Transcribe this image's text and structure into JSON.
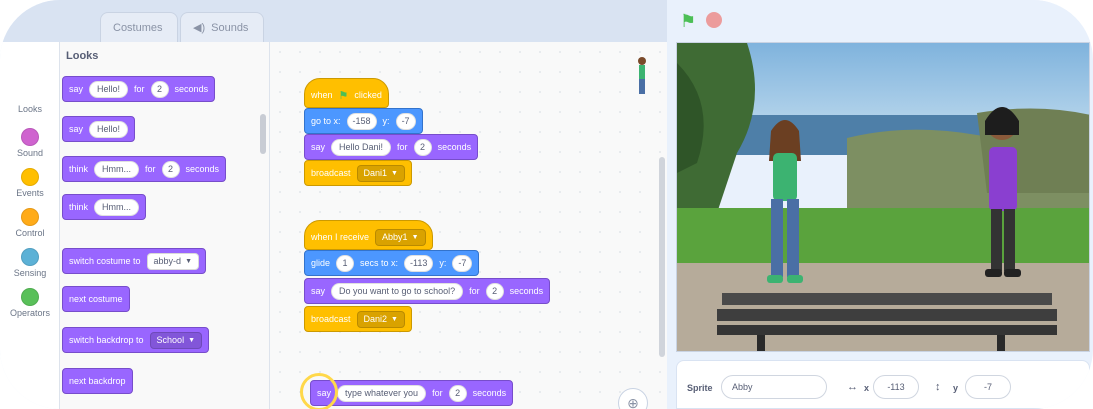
{
  "tabs": {
    "costumes": "Costumes",
    "sounds": "Sounds"
  },
  "categories": [
    {
      "label": "Looks",
      "color": "#9966ff",
      "icon": "looks-dot-icon"
    },
    {
      "label": "Sound",
      "color": "#cf63cf",
      "icon": "sound-dot-icon"
    },
    {
      "label": "Events",
      "color": "#ffbf00",
      "icon": "events-dot-icon"
    },
    {
      "label": "Control",
      "color": "#ffab19",
      "icon": "control-dot-icon"
    },
    {
      "label": "Sensing",
      "color": "#5cb1d6",
      "icon": "sensing-dot-icon"
    },
    {
      "label": "Operators",
      "color": "#59c059",
      "icon": "operators-dot-icon"
    }
  ],
  "palette": {
    "title": "Looks",
    "say_for": {
      "say": "say",
      "text": "Hello!",
      "for": "for",
      "secs": "2",
      "seconds": "seconds"
    },
    "say": {
      "say": "say",
      "text": "Hello!"
    },
    "think_for": {
      "think": "think",
      "text": "Hmm...",
      "for": "for",
      "secs": "2",
      "seconds": "seconds"
    },
    "think": {
      "think": "think",
      "text": "Hmm..."
    },
    "switch_costume": {
      "label": "switch costume to",
      "value": "abby-d"
    },
    "next_costume": "next costume",
    "switch_backdrop": {
      "label": "switch backdrop to",
      "value": "School"
    },
    "next_backdrop": "next backdrop"
  },
  "script1": {
    "when_clicked": {
      "when": "when",
      "clicked": "clicked"
    },
    "goto": {
      "label": "go to x:",
      "x": "-158",
      "y_label": "y:",
      "y": "-7"
    },
    "say_for": {
      "say": "say",
      "text": "Hello Dani!",
      "for": "for",
      "secs": "2",
      "seconds": "seconds"
    },
    "broadcast": {
      "label": "broadcast",
      "value": "Dani1"
    }
  },
  "script2": {
    "when_receive": {
      "label": "when I receive",
      "value": "Abby1"
    },
    "glide": {
      "glide": "glide",
      "secs": "1",
      "label": "secs to x:",
      "x": "-113",
      "y_label": "y:",
      "y": "-7"
    },
    "say_for": {
      "say": "say",
      "text": "Do you want to go to school?",
      "for": "for",
      "secs": "2",
      "seconds": "seconds"
    },
    "broadcast": {
      "label": "broadcast",
      "value": "Dani2"
    }
  },
  "script3": {
    "say_for": {
      "say": "say",
      "text": "type whatever you",
      "for": "for",
      "secs": "2",
      "seconds": "seconds"
    }
  },
  "workspace": {
    "zoom_icon": "zoom-in-icon"
  },
  "sprite_info": {
    "sprite_label": "Sprite",
    "sprite_name": "Abby",
    "x_label": "x",
    "x": "-113",
    "y_label": "y",
    "y": "-7"
  },
  "colors": {
    "looks": "#9966ff",
    "motion": "#4c97ff",
    "events": "#ffbf00"
  }
}
